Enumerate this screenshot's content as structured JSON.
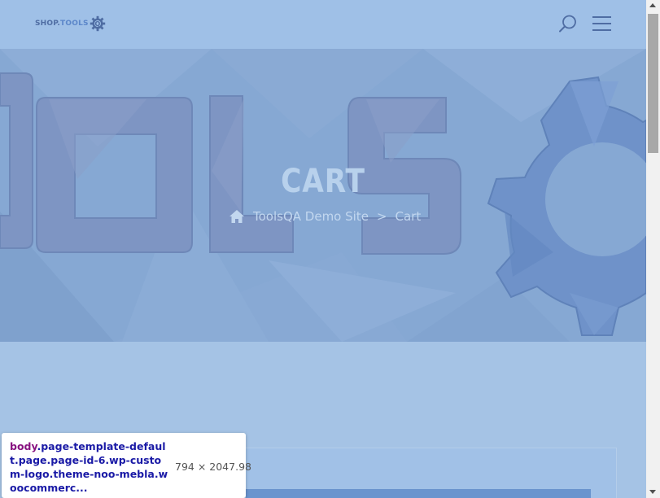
{
  "header": {
    "logo_shop": "SHOP.",
    "logo_tools": "TOOLS",
    "logo_q": "Q",
    "icons": {
      "search": "search-icon",
      "menu": "hamburger-menu-icon",
      "logo_gear": "gear-icon"
    }
  },
  "hero": {
    "title": "CART",
    "breadcrumb": {
      "home_icon": "home-icon",
      "home_label": "ToolsQA Demo Site",
      "separator": ">",
      "current": "Cart"
    }
  },
  "inspector_tooltip": {
    "tag": "body",
    "classes": ".page-template-default.page.page-id-6.wp-custom-logo.theme-noo-mebla.woocommerc...",
    "dimensions": "794 × 2047.98"
  },
  "colors": {
    "overlay": "#a5c3e5",
    "hero": "#86a8d3",
    "hero_text": "#b8d1ec",
    "tooltip_tag": "#881280",
    "tooltip_class": "#1a1aa6"
  }
}
